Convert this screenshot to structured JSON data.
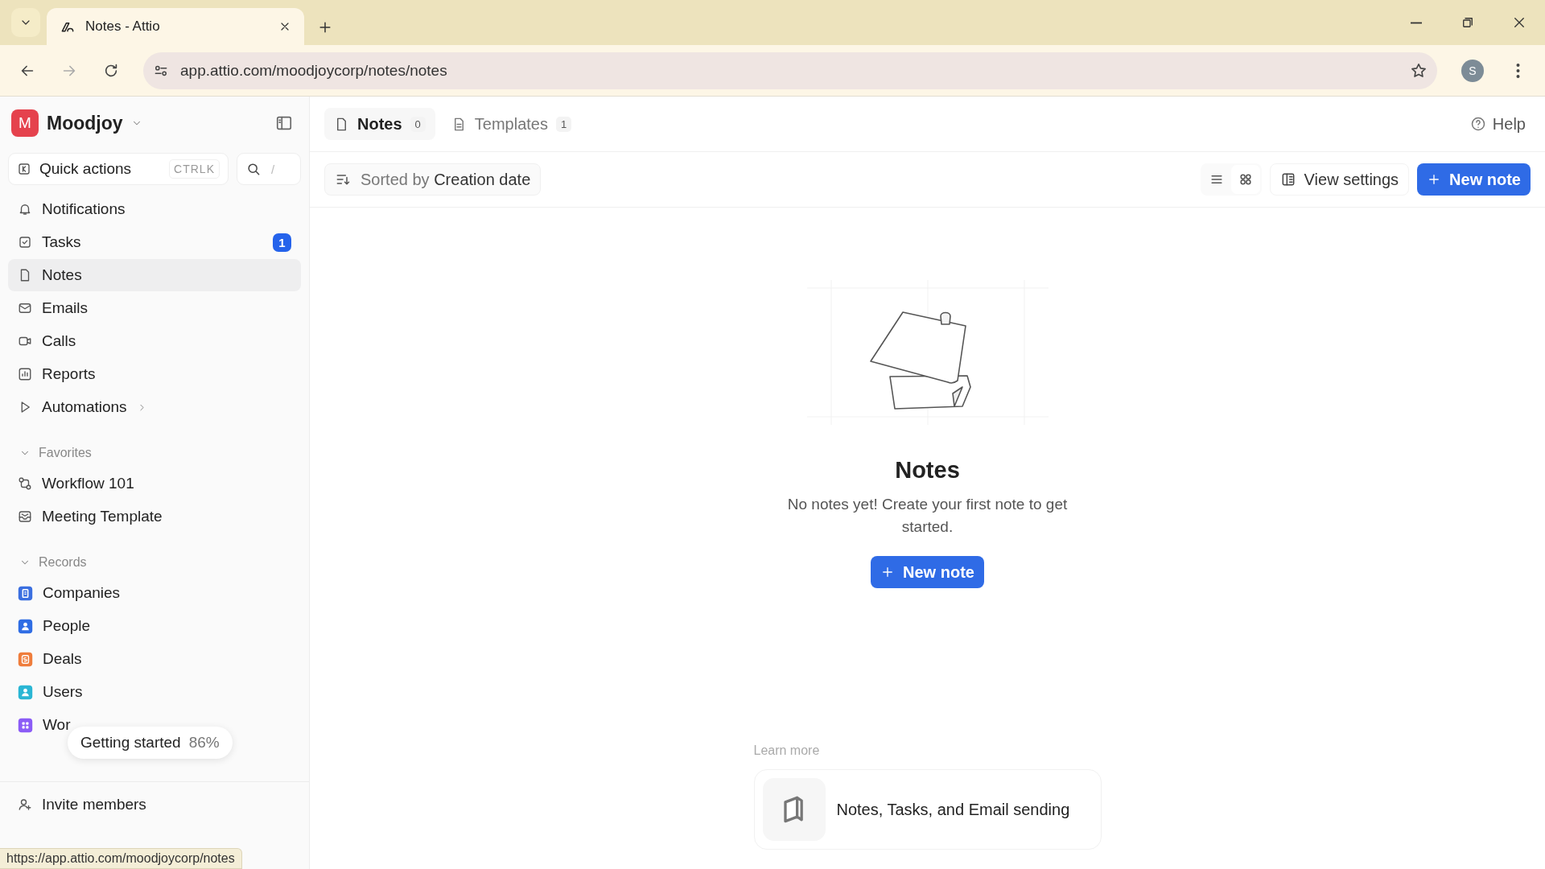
{
  "browser": {
    "tabs": [
      {
        "title": "Notes - Attio",
        "selected": true
      }
    ],
    "url": "app.attio.com/moodjoycorp/notes/notes",
    "profile_initial": "S"
  },
  "workspace": {
    "initial": "M",
    "name": "Moodjoy"
  },
  "quick_actions": {
    "label": "Quick actions",
    "shortcut": "CTRLK",
    "search_shortcut": "/"
  },
  "nav": [
    {
      "kind": "bell",
      "label": "Notifications",
      "selected": false
    },
    {
      "kind": "check",
      "label": "Tasks",
      "badge": "1",
      "selected": false
    },
    {
      "kind": "note",
      "label": "Notes",
      "selected": true
    },
    {
      "kind": "mail",
      "label": "Emails",
      "selected": false
    },
    {
      "kind": "video",
      "label": "Calls",
      "selected": false
    },
    {
      "kind": "chart",
      "label": "Reports",
      "selected": false
    },
    {
      "kind": "play",
      "label": "Automations",
      "submenu": true,
      "selected": false
    }
  ],
  "favorites": {
    "title": "Favorites",
    "expanded": true,
    "items": [
      {
        "kind": "flow",
        "label": "Workflow 101"
      },
      {
        "kind": "tray",
        "label": "Meeting Template"
      }
    ]
  },
  "records": {
    "title": "Records",
    "expanded": true,
    "items": [
      {
        "kind": "building",
        "label": "Companies",
        "color": "#3b6fe0"
      },
      {
        "kind": "person",
        "label": "People",
        "color": "#2f6de4"
      },
      {
        "kind": "dollar",
        "label": "Deals",
        "color": "#ef7d3c"
      },
      {
        "kind": "person",
        "label": "Users",
        "color": "#2ab6d4"
      },
      {
        "kind": "grid",
        "label": "Wor",
        "color": "#8b5cf6"
      }
    ]
  },
  "getting_started": {
    "label": "Getting started",
    "percent": "86%"
  },
  "invite": {
    "label": "Invite members"
  },
  "status_url": "https://app.attio.com/moodjoycorp/notes",
  "main": {
    "tabs": [
      {
        "label": "Notes",
        "count": "0",
        "selected": true
      },
      {
        "label": "Templates",
        "count": "1",
        "selected": false
      }
    ],
    "help": "Help",
    "sort": {
      "prefix": "Sorted by",
      "value": "Creation date"
    },
    "view_settings": "View settings",
    "new_note": "New note",
    "empty": {
      "title": "Notes",
      "description": "No notes yet! Create your first note to get started.",
      "button": "New note"
    },
    "learn_more": {
      "title": "Learn more",
      "cards": [
        {
          "label": "Notes, Tasks, and Email sending"
        }
      ]
    }
  }
}
